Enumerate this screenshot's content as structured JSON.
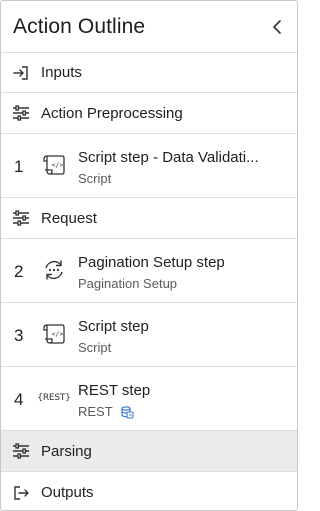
{
  "header": {
    "title": "Action Outline"
  },
  "inputs": {
    "label": "Inputs"
  },
  "preprocessing": {
    "label": "Action Preprocessing"
  },
  "steps_pre": [
    {
      "number": "1",
      "title": "Script step - Data Validati...",
      "subtitle": "Script",
      "icon": "script-icon"
    }
  ],
  "request": {
    "label": "Request"
  },
  "steps_req": [
    {
      "number": "2",
      "title": "Pagination Setup step",
      "subtitle": "Pagination Setup",
      "icon": "pagination-icon"
    },
    {
      "number": "3",
      "title": "Script step",
      "subtitle": "Script",
      "icon": "script-icon"
    },
    {
      "number": "4",
      "title": "REST step",
      "subtitle": "REST",
      "icon": "rest-icon",
      "icon_text": "{REST}",
      "badge_icon": "datasource-icon"
    }
  ],
  "parsing": {
    "label": "Parsing"
  },
  "outputs": {
    "label": "Outputs"
  },
  "colors": {
    "active_row": "#ebebeb",
    "divider": "#dedede",
    "badge_blue": "#2f73c9"
  }
}
